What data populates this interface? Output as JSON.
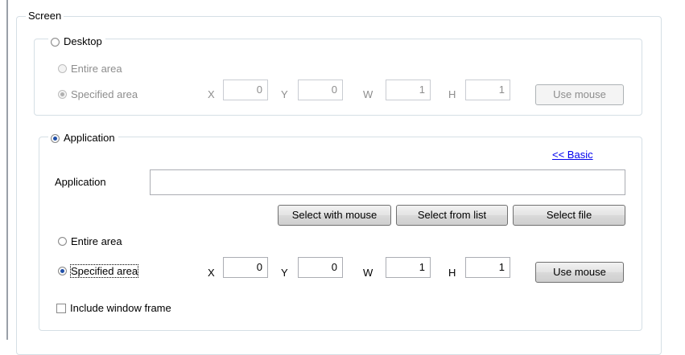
{
  "screen_group": {
    "title": "Screen"
  },
  "desktop": {
    "label": "Desktop",
    "entire_area": "Entire area",
    "specified_area": "Specified area",
    "x_label": "X",
    "x_value": "0",
    "y_label": "Y",
    "y_value": "0",
    "w_label": "W",
    "w_value": "1",
    "h_label": "H",
    "h_value": "1",
    "use_mouse": "Use mouse"
  },
  "application": {
    "label": "Application",
    "basic_link": "<< Basic",
    "field_label": "Application",
    "field_value": "",
    "select_with_mouse": "Select with mouse",
    "select_from_list": "Select from list",
    "select_file": "Select file",
    "entire_area": "Entire area",
    "specified_area": "Specified area",
    "x_label": "X",
    "x_value": "0",
    "y_label": "Y",
    "y_value": "0",
    "w_label": "W",
    "w_value": "1",
    "h_label": "H",
    "h_value": "1",
    "use_mouse": "Use mouse",
    "include_frame": "Include window frame"
  }
}
